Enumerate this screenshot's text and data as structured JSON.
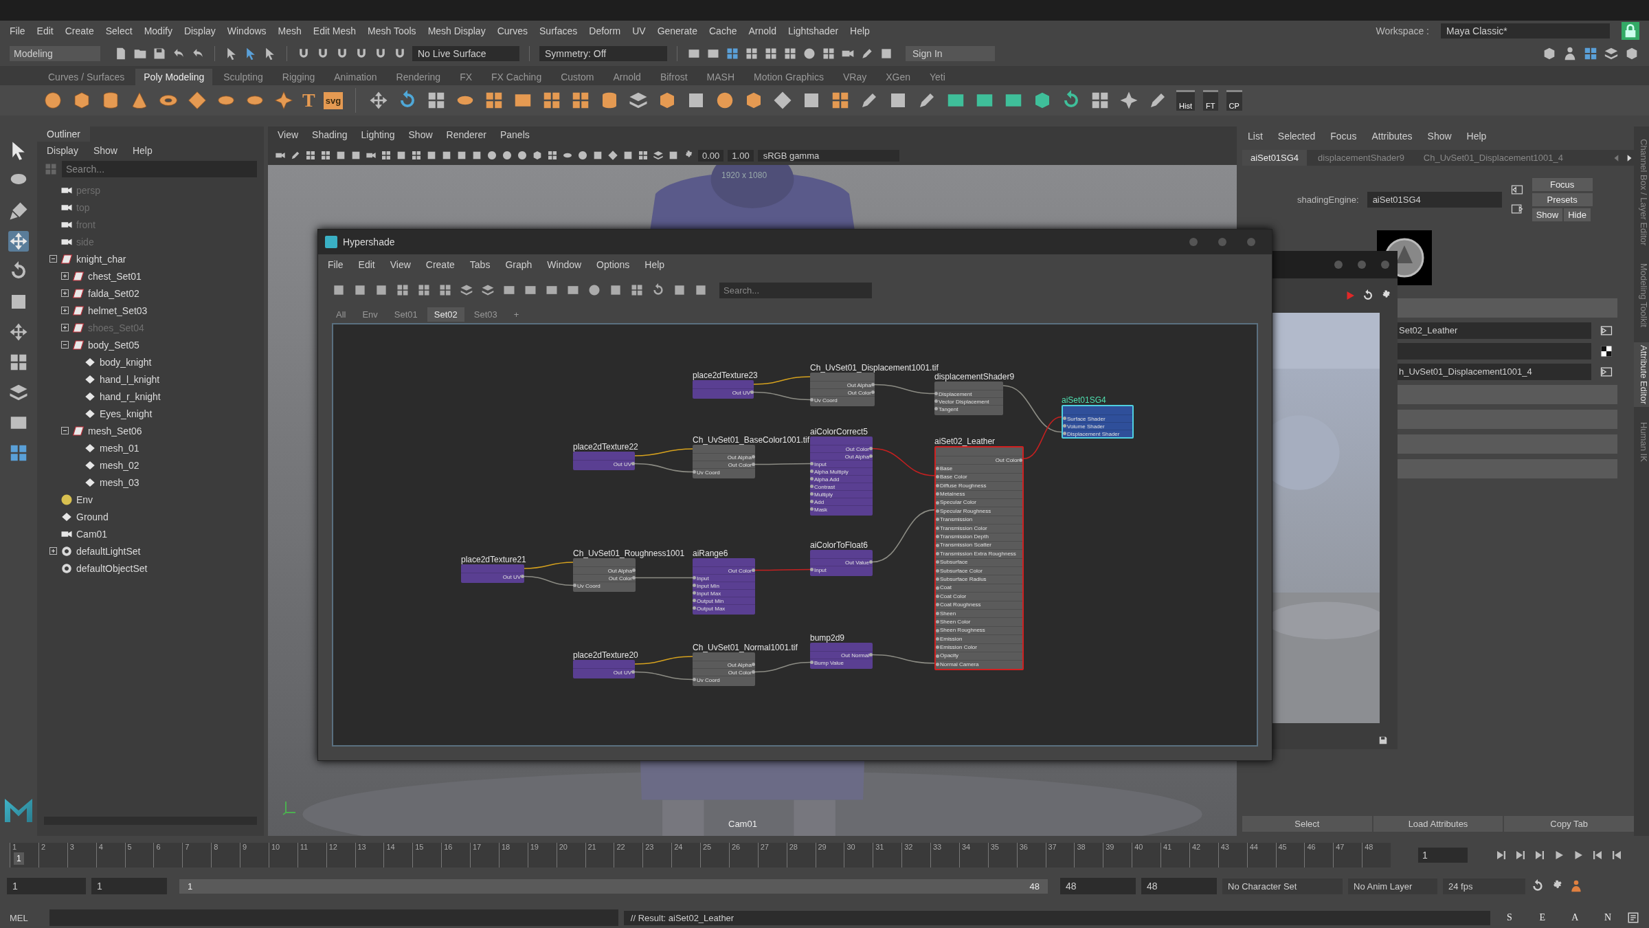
{
  "menu_bar": {
    "items": [
      "File",
      "Edit",
      "Create",
      "Select",
      "Modify",
      "Display",
      "Windows",
      "Mesh",
      "Edit Mesh",
      "Mesh Tools",
      "Mesh Display",
      "Curves",
      "Surfaces",
      "Deform",
      "UV",
      "Generate",
      "Cache",
      "Arnold",
      "Lightshader",
      "Help"
    ],
    "workspace_label": "Workspace :",
    "workspace": "Maya Classic*"
  },
  "status_line": {
    "mode": "Modeling",
    "live_surface": "No Live Surface",
    "symmetry": "Symmetry: Off",
    "sign_in": "Sign In"
  },
  "shelf": {
    "tabs": [
      {
        "label": "Curves / Surfaces",
        "selected": false
      },
      {
        "label": "Poly Modeling",
        "selected": true
      },
      {
        "label": "Sculpting",
        "selected": false
      },
      {
        "label": "Rigging",
        "selected": false
      },
      {
        "label": "Animation",
        "selected": false
      },
      {
        "label": "Rendering",
        "selected": false
      },
      {
        "label": "FX",
        "selected": false
      },
      {
        "label": "FX Caching",
        "selected": false
      },
      {
        "label": "Custom",
        "selected": false
      },
      {
        "label": "Arnold",
        "selected": false
      },
      {
        "label": "Bifrost",
        "selected": false
      },
      {
        "label": "MASH",
        "selected": false
      },
      {
        "label": "Motion Graphics",
        "selected": false
      },
      {
        "label": "VRay",
        "selected": false
      },
      {
        "label": "XGen",
        "selected": false
      },
      {
        "label": "Yeti",
        "selected": false
      }
    ],
    "text_tools": [
      "T",
      "svg"
    ],
    "history_tools": [
      "Hist",
      "FT",
      "CP"
    ]
  },
  "outliner": {
    "title": "Outliner",
    "menu": [
      "Display",
      "Show",
      "Help"
    ],
    "search": {
      "placeholder": "Search..."
    },
    "items": [
      {
        "label": "persp",
        "kind": "camera",
        "dimmed": true
      },
      {
        "label": "top",
        "kind": "camera",
        "dimmed": true
      },
      {
        "label": "front",
        "kind": "camera",
        "dimmed": true
      },
      {
        "label": "side",
        "kind": "camera",
        "dimmed": true
      },
      {
        "label": "knight_char",
        "kind": "group",
        "dimmed": false,
        "expanded": true,
        "children": [
          {
            "label": "chest_Set01",
            "kind": "group",
            "dimmed": false,
            "expanded": false
          },
          {
            "label": "falda_Set02",
            "kind": "group",
            "dimmed": false,
            "expanded": false
          },
          {
            "label": "helmet_Set03",
            "kind": "group",
            "dimmed": false,
            "expanded": false
          },
          {
            "label": "shoes_Set04",
            "kind": "group",
            "dimmed": true,
            "expanded": false
          },
          {
            "label": "body_Set05",
            "kind": "group",
            "dimmed": false,
            "expanded": true,
            "children": [
              {
                "label": "body_knight",
                "kind": "mesh",
                "dimmed": false
              },
              {
                "label": "hand_l_knight",
                "kind": "mesh",
                "dimmed": false
              },
              {
                "label": "hand_r_knight",
                "kind": "mesh",
                "dimmed": false
              },
              {
                "label": "Eyes_knight",
                "kind": "mesh",
                "dimmed": false
              }
            ]
          },
          {
            "label": "mesh_Set06",
            "kind": "group",
            "dimmed": false,
            "expanded": true,
            "children": [
              {
                "label": "mesh_01",
                "kind": "mesh",
                "dimmed": false
              },
              {
                "label": "mesh_02",
                "kind": "mesh",
                "dimmed": false
              },
              {
                "label": "mesh_03",
                "kind": "mesh",
                "dimmed": false
              }
            ]
          }
        ]
      },
      {
        "label": "Env",
        "kind": "env",
        "dimmed": false
      },
      {
        "label": "Ground",
        "kind": "mesh",
        "dimmed": false
      },
      {
        "label": "Cam01",
        "kind": "camera",
        "dimmed": false
      },
      {
        "label": "defaultLightSet",
        "kind": "set",
        "dimmed": false,
        "expanded": false
      },
      {
        "label": "defaultObjectSet",
        "kind": "set",
        "dimmed": false
      }
    ]
  },
  "viewport": {
    "menu": [
      "View",
      "Shading",
      "Lighting",
      "Show",
      "Renderer",
      "Panels"
    ],
    "exposure": "0.00",
    "gamma": "1.00",
    "color_space": "sRGB gamma",
    "resolution": "1920 x 1080",
    "camera": "Cam01"
  },
  "hypershade": {
    "title": "Hypershade",
    "menu": [
      "File",
      "Edit",
      "View",
      "Create",
      "Tabs",
      "Graph",
      "Window",
      "Options",
      "Help"
    ],
    "search": {
      "placeholder": "Search..."
    },
    "tabs": [
      {
        "label": "All",
        "selected": false
      },
      {
        "label": "Env",
        "selected": false
      },
      {
        "label": "Set01",
        "selected": false
      },
      {
        "label": "Set02",
        "selected": true
      },
      {
        "label": "Set03",
        "selected": false
      }
    ],
    "add_tab": "+",
    "nodes": [
      {
        "title": "place2dTexture23",
        "kind": "place2d",
        "selected": false,
        "ports": [
          {
            "label": "Out UV",
            "kind": "output"
          }
        ]
      },
      {
        "title": "Ch_UvSet01_Displacement1001.tif",
        "kind": "file",
        "selected": false,
        "ports": [
          {
            "label": "Out Alpha",
            "kind": "output"
          },
          {
            "label": "Out Color",
            "kind": "output"
          },
          {
            "label": "Uv Coord",
            "kind": "input"
          }
        ]
      },
      {
        "title": "displacementShader9",
        "kind": "file",
        "selected": false,
        "ports": [
          {
            "label": "Displacement",
            "kind": "input"
          },
          {
            "label": "Vector Displacement",
            "kind": "input"
          },
          {
            "label": "Tangent",
            "kind": "input"
          }
        ]
      },
      {
        "title": "aiSet01SG4",
        "kind": "engine",
        "selected": false,
        "ports": [
          {
            "label": "Surface Shader",
            "kind": "input"
          },
          {
            "label": "Volume Shader",
            "kind": "input"
          },
          {
            "label": "Displacement Shader",
            "kind": "input"
          }
        ]
      },
      {
        "title": "place2dTexture22",
        "kind": "place2d",
        "selected": false,
        "ports": [
          {
            "label": "Out UV",
            "kind": "output"
          }
        ]
      },
      {
        "title": "Ch_UvSet01_BaseColor1001.tif",
        "kind": "file",
        "selected": false,
        "ports": [
          {
            "label": "Out Alpha",
            "kind": "output"
          },
          {
            "label": "Out Color",
            "kind": "output"
          },
          {
            "label": "Uv Coord",
            "kind": "input"
          }
        ]
      },
      {
        "title": "aiColorCorrect5",
        "kind": "utility",
        "selected": false,
        "ports": [
          {
            "label": "Out Color",
            "kind": "output"
          },
          {
            "label": "Out Alpha",
            "kind": "output"
          },
          {
            "label": "Input",
            "kind": "input"
          },
          {
            "label": "Alpha Multiply",
            "kind": "input"
          },
          {
            "label": "Alpha Add",
            "kind": "input"
          },
          {
            "label": "Contrast",
            "kind": "input"
          },
          {
            "label": "Multiply",
            "kind": "input"
          },
          {
            "label": "Add",
            "kind": "input"
          },
          {
            "label": "Mask",
            "kind": "input"
          }
        ]
      },
      {
        "title": "aiSet02_Leather",
        "kind": "file",
        "selected": true,
        "ports": [
          {
            "label": "Out Color",
            "kind": "output"
          },
          {
            "label": "Base",
            "kind": "input"
          },
          {
            "label": "Base Color",
            "kind": "input"
          },
          {
            "label": "Diffuse Roughness",
            "kind": "input"
          },
          {
            "label": "Metalness",
            "kind": "input"
          },
          {
            "label": "Specular Color",
            "kind": "input"
          },
          {
            "label": "Specular Roughness",
            "kind": "input"
          },
          {
            "label": "Transmission",
            "kind": "input"
          },
          {
            "label": "Transmission Color",
            "kind": "input"
          },
          {
            "label": "Transmission Depth",
            "kind": "input"
          },
          {
            "label": "Transmission Scatter",
            "kind": "input"
          },
          {
            "label": "Transmission Extra Roughness",
            "kind": "input"
          },
          {
            "label": "Subsurface",
            "kind": "input"
          },
          {
            "label": "Subsurface Color",
            "kind": "input"
          },
          {
            "label": "Subsurface Radius",
            "kind": "input"
          },
          {
            "label": "Coat",
            "kind": "input"
          },
          {
            "label": "Coat Color",
            "kind": "input"
          },
          {
            "label": "Coat Roughness",
            "kind": "input"
          },
          {
            "label": "Sheen",
            "kind": "input"
          },
          {
            "label": "Sheen Color",
            "kind": "input"
          },
          {
            "label": "Sheen Roughness",
            "kind": "input"
          },
          {
            "label": "Emission",
            "kind": "input"
          },
          {
            "label": "Emission Color",
            "kind": "input"
          },
          {
            "label": "Opacity",
            "kind": "input"
          },
          {
            "label": "Normal Camera",
            "kind": "input"
          }
        ]
      },
      {
        "title": "place2dTexture21",
        "kind": "place2d",
        "selected": false,
        "ports": [
          {
            "label": "Out UV",
            "kind": "output"
          }
        ]
      },
      {
        "title": "Ch_UvSet01_Roughness1001",
        "kind": "file",
        "selected": false,
        "ports": [
          {
            "label": "Out Alpha",
            "kind": "output"
          },
          {
            "label": "Out Color",
            "kind": "output"
          },
          {
            "label": "Uv Coord",
            "kind": "input"
          }
        ]
      },
      {
        "title": "aiRange6",
        "kind": "utility",
        "selected": false,
        "ports": [
          {
            "label": "Out Color",
            "kind": "output"
          },
          {
            "label": "Input",
            "kind": "input"
          },
          {
            "label": "Input Min",
            "kind": "input"
          },
          {
            "label": "Input Max",
            "kind": "input"
          },
          {
            "label": "Output Min",
            "kind": "input"
          },
          {
            "label": "Output Max",
            "kind": "input"
          }
        ]
      },
      {
        "title": "aiColorToFloat6",
        "kind": "utility",
        "selected": false,
        "ports": [
          {
            "label": "Out Value",
            "kind": "output"
          },
          {
            "label": "Input",
            "kind": "input"
          }
        ]
      },
      {
        "title": "place2dTexture20",
        "kind": "place2d",
        "selected": false,
        "ports": [
          {
            "label": "Out UV",
            "kind": "output"
          }
        ]
      },
      {
        "title": "Ch_UvSet01_Normal1001.tif",
        "kind": "file",
        "selected": false,
        "ports": [
          {
            "label": "Out Alpha",
            "kind": "output"
          },
          {
            "label": "Out Color",
            "kind": "output"
          },
          {
            "label": "Uv Coord",
            "kind": "input"
          }
        ]
      },
      {
        "title": "bump2d9",
        "kind": "utility",
        "selected": false,
        "ports": [
          {
            "label": "Out Normal",
            "kind": "output"
          },
          {
            "label": "Bump Value",
            "kind": "input"
          }
        ]
      }
    ]
  },
  "attribute_editor": {
    "menu": [
      "List",
      "Selected",
      "Focus",
      "Attributes",
      "Show",
      "Help"
    ],
    "tabs": [
      {
        "label": "aiSet01SG4",
        "selected": true
      },
      {
        "label": "displacementShader9",
        "selected": false
      },
      {
        "label": "Ch_UvSet01_Displacement1001_4",
        "selected": false
      }
    ],
    "shading_engine_label": "shadingEngine:",
    "shading_engine": "aiSet01SG4",
    "buttons": [
      "Focus",
      "Presets",
      "Show",
      "Hide"
    ],
    "fields": [
      {
        "kind": "link",
        "value": "Set02_Leather"
      },
      {
        "kind": "checker"
      },
      {
        "kind": "link",
        "value": "h_UvSet01_Displacement1001_4"
      }
    ],
    "footer_buttons": [
      "Select",
      "Load Attributes",
      "Copy Tab"
    ]
  },
  "side_tabs": [
    {
      "label": "Channel Box / Layer Editor",
      "selected": false
    },
    {
      "label": "Modeling Toolkit",
      "selected": false
    },
    {
      "label": "Attribute Editor",
      "selected": true
    },
    {
      "label": "Human IK",
      "selected": false
    }
  ],
  "timeline": {
    "ticks": [
      "1",
      "2",
      "3",
      "4",
      "5",
      "6",
      "7",
      "8",
      "9",
      "10",
      "11",
      "12",
      "13",
      "14",
      "15",
      "16",
      "17",
      "18",
      "19",
      "20",
      "21",
      "22",
      "23",
      "24",
      "25",
      "26",
      "27",
      "28",
      "29",
      "30",
      "31",
      "32",
      "33",
      "34",
      "35",
      "36",
      "37",
      "38",
      "39",
      "40",
      "41",
      "42",
      "43",
      "44",
      "45",
      "46",
      "47",
      "48"
    ],
    "current": "1",
    "frame_field": "1",
    "level": 0
  },
  "range_slider": {
    "start": "1",
    "range_start": "1",
    "slider_start": "1",
    "slider_end": "48",
    "range_end": "48",
    "end": "48",
    "level": 1,
    "character_set": "No Character Set",
    "anim_layer": "No Anim Layer",
    "fps": "24 fps"
  },
  "command_line": {
    "language": "MEL",
    "result": "// Result: aiSet02_Leather",
    "status_letters": [
      "S",
      "E",
      "A",
      "N"
    ]
  }
}
